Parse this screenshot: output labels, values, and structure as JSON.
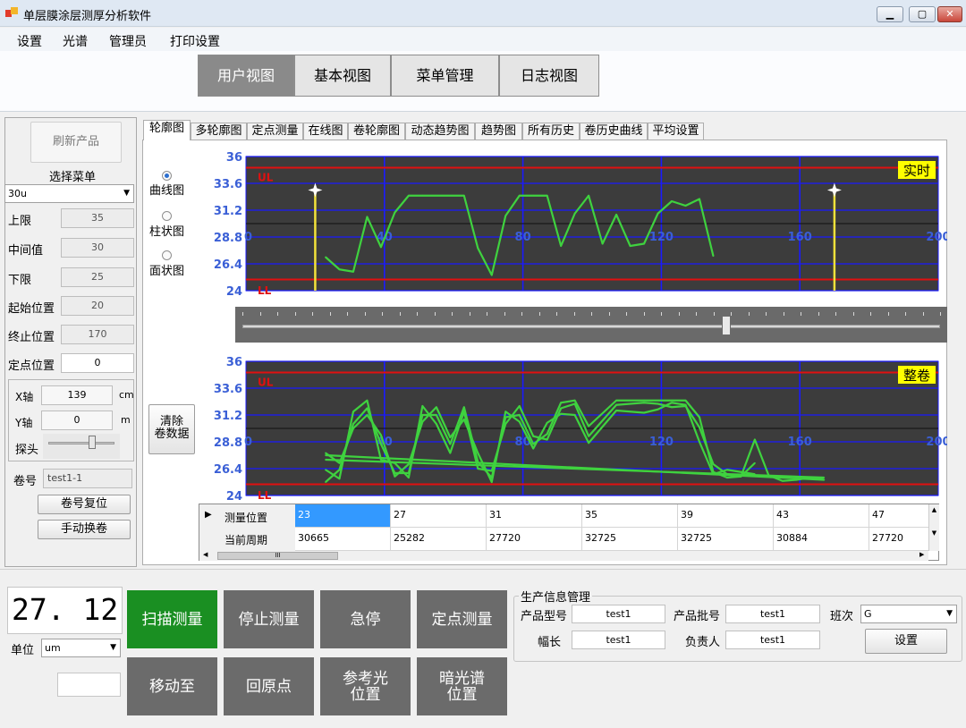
{
  "window": {
    "title": "单层膜涂层测厚分析软件",
    "min": "▁",
    "max": "▢",
    "close": "✕"
  },
  "menu": [
    "设置",
    "光谱",
    "管理员",
    "打印设置"
  ],
  "views": [
    {
      "label": "用户视图",
      "active": true
    },
    {
      "label": "基本视图",
      "active": false
    },
    {
      "label": "菜单管理",
      "active": false
    },
    {
      "label": "日志视图",
      "active": false
    }
  ],
  "left": {
    "refresh": "刷新产品",
    "select_menu": "选择菜单",
    "product": "30u",
    "fields": [
      {
        "label": "上限",
        "value": "35"
      },
      {
        "label": "中间值",
        "value": "30"
      },
      {
        "label": "下限",
        "value": "25"
      },
      {
        "label": "起始位置",
        "value": "20"
      },
      {
        "label": "终止位置",
        "value": "170"
      },
      {
        "label": "定点位置",
        "value": "0"
      }
    ],
    "x_axis": {
      "label": "X轴",
      "value": "139",
      "unit": "cm"
    },
    "y_axis": {
      "label": "Y轴",
      "value": "0",
      "unit": "m"
    },
    "probe": "探头",
    "roll_no_label": "卷号",
    "roll_no": "test1-1",
    "roll_reset": "卷号复位",
    "manual_change": "手动换卷"
  },
  "chart_tabs": [
    "轮廓图",
    "多轮廓图",
    "定点测量",
    "在线图",
    "卷轮廓图",
    "动态趋势图",
    "趋势图",
    "所有历史",
    "卷历史曲线",
    "平均设置"
  ],
  "chart_modes": [
    "曲线图",
    "柱状图",
    "面状图"
  ],
  "clear_button": "清除\n卷数据",
  "colors": {
    "plot_bg": "#3c3c3c",
    "grid": "#1a1aff",
    "limit": "#e01010",
    "curve": "#3fd23f",
    "marker": "#f2e23a",
    "label_bg": "#ffff00"
  },
  "charts": [
    {
      "tag": "实时",
      "yticks": [
        "36",
        "33.6",
        "31.2",
        "28.8",
        "26.4",
        "24"
      ],
      "xticks": [
        "0",
        "40",
        "80",
        "120",
        "160",
        "200"
      ],
      "ul": "UL",
      "ll": "LL",
      "markers": [
        20,
        170
      ]
    },
    {
      "tag": "整卷",
      "yticks": [
        "36",
        "33.6",
        "31.2",
        "28.8",
        "26.4",
        "24"
      ],
      "xticks": [
        "0",
        "40",
        "80",
        "120",
        "160",
        "200"
      ],
      "ul": "UL",
      "ll": "LL"
    }
  ],
  "chart_data": [
    {
      "type": "line",
      "title": "实时",
      "ylim": [
        24,
        36
      ],
      "xlim": [
        0,
        200
      ],
      "upper_limit": 35,
      "lower_limit": 25,
      "series": [
        {
          "x": [
            23,
            27,
            31,
            35,
            39,
            43,
            47,
            51,
            55,
            63,
            67,
            71,
            75,
            79,
            83,
            87,
            91,
            95,
            99,
            103,
            107,
            111,
            115,
            119,
            123,
            127,
            131,
            135
          ],
          "y": [
            27.0,
            25.9,
            25.7,
            30.6,
            27.9,
            31.0,
            32.5,
            32.5,
            32.5,
            32.5,
            27.8,
            25.4,
            30.7,
            32.5,
            32.5,
            32.5,
            28.0,
            30.9,
            32.5,
            28.2,
            30.8,
            28.0,
            28.2,
            30.9,
            32.0,
            31.6,
            32.2,
            27.1
          ]
        }
      ]
    },
    {
      "type": "line",
      "title": "整卷",
      "ylim": [
        24,
        36
      ],
      "xlim": [
        0,
        200
      ],
      "upper_limit": 35,
      "lower_limit": 25,
      "series": [
        {
          "x": [
            23,
            27,
            31,
            35,
            39,
            43,
            47,
            51,
            55,
            59,
            63,
            67,
            71,
            75,
            79,
            83,
            87,
            91,
            95,
            99,
            107,
            115,
            119,
            123,
            127,
            131,
            135,
            139,
            143,
            147,
            151,
            155,
            159,
            163,
            167
          ],
          "y": [
            25.2,
            26.3,
            30.4,
            31.8,
            28.6,
            26.0,
            26.0,
            31.2,
            31.2,
            28.6,
            31.9,
            27.0,
            25.6,
            31.0,
            31.2,
            28.6,
            29.5,
            32.3,
            32.5,
            30.2,
            32.5,
            32.5,
            32.5,
            32.5,
            32.5,
            31.0,
            26.1,
            25.6,
            25.7,
            29.0,
            25.8,
            25.3,
            25.4,
            25.6,
            25.4
          ]
        },
        {
          "x": [
            23,
            27,
            31,
            35,
            39,
            43,
            47,
            51,
            55,
            59,
            63,
            67,
            71,
            75,
            79,
            83,
            87,
            91,
            95,
            99,
            107,
            115,
            119,
            123,
            127,
            131,
            135,
            139,
            143,
            147
          ],
          "y": [
            26.3,
            25.5,
            31.5,
            32.5,
            27.2,
            26.9,
            25.6,
            32.0,
            30.4,
            27.8,
            31.5,
            26.4,
            26.2,
            30.4,
            32.0,
            29.3,
            29.0,
            31.8,
            32.2,
            29.3,
            32.1,
            32.3,
            32.2,
            31.9,
            32.0,
            30.1,
            26.8,
            25.9,
            25.7,
            26.9
          ]
        },
        {
          "x": [
            23,
            27,
            31,
            35,
            39,
            43,
            47,
            51,
            55,
            59,
            63,
            67,
            71,
            75,
            79,
            83,
            87,
            91,
            95,
            99,
            107,
            115,
            119,
            123,
            127,
            131,
            135,
            139,
            143,
            147
          ],
          "y": [
            27.8,
            26.9,
            30.0,
            31.2,
            29.4,
            25.7,
            26.8,
            30.6,
            31.9,
            29.2,
            30.8,
            27.8,
            25.2,
            31.5,
            30.6,
            28.2,
            30.5,
            31.3,
            31.2,
            28.7,
            31.6,
            31.4,
            31.7,
            32.3,
            32.1,
            28.8,
            25.9,
            26.3,
            26.1,
            25.9
          ]
        },
        {
          "x": [
            23,
            167
          ],
          "y": [
            27.6,
            25.4
          ]
        },
        {
          "x": [
            23,
            167
          ],
          "y": [
            27.2,
            25.6
          ]
        }
      ]
    }
  ],
  "grid": {
    "row_headers": [
      "测量位置",
      "当前周期"
    ],
    "cols": [
      [
        "23",
        "30665"
      ],
      [
        "27",
        "25282"
      ],
      [
        "31",
        "27720"
      ],
      [
        "35",
        "32725"
      ],
      [
        "39",
        "32725"
      ],
      [
        "43",
        "30884"
      ],
      [
        "47",
        "27720"
      ]
    ],
    "scroll_thumb": "III"
  },
  "bottom": {
    "reading": "27. 12",
    "unit_label": "单位",
    "unit": "um",
    "buttons_row1": [
      "扫描测量",
      "停止测量",
      "急停",
      "定点测量"
    ],
    "buttons_row2": [
      "移动至",
      "回原点",
      "参考光\n位置",
      "暗光谱\n位置"
    ],
    "move_to_value": ""
  },
  "production": {
    "title": "生产信息管理",
    "model_label": "产品型号",
    "model": "test1",
    "batch_label": "产品批号",
    "batch": "test1",
    "shift_label": "班次",
    "shift": "G",
    "width_label": "幅长",
    "width": "test1",
    "owner_label": "负责人",
    "owner": "test1",
    "settings": "设置"
  }
}
